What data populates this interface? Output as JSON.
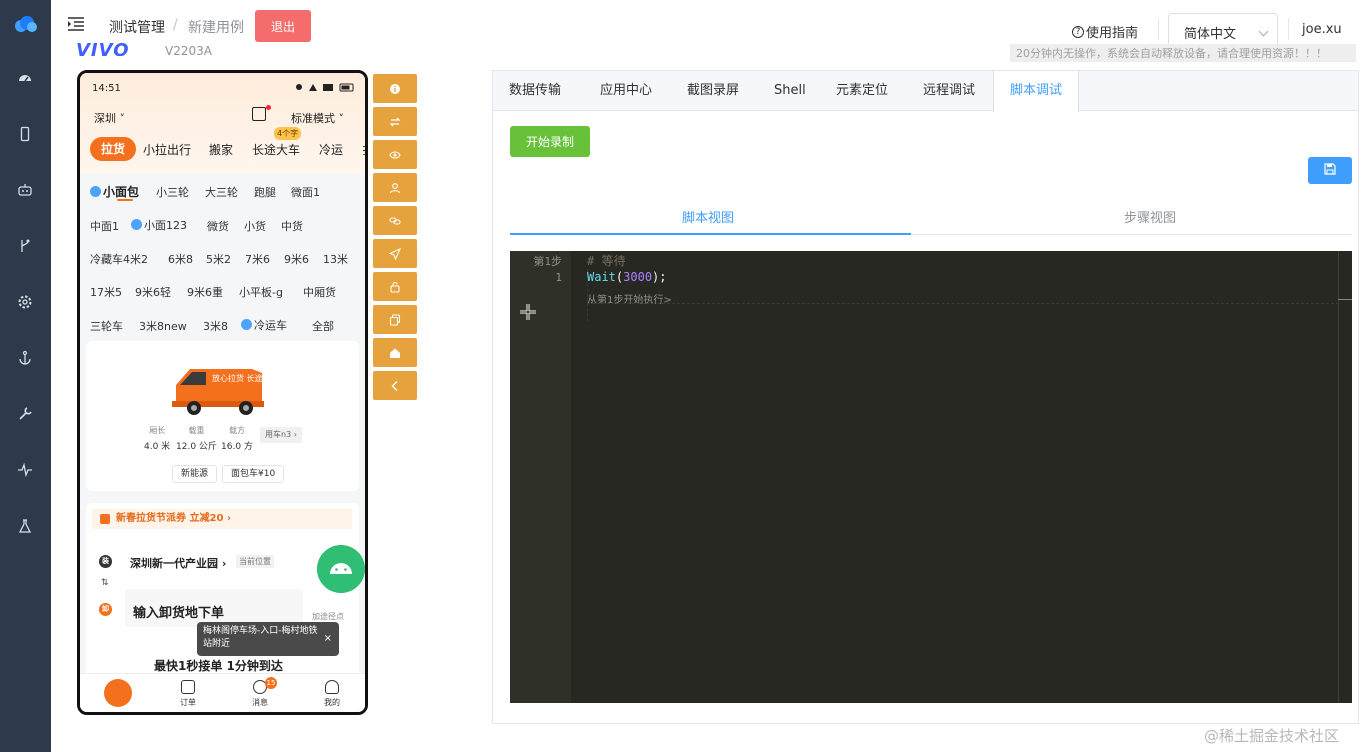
{
  "header": {
    "breadcrumb": [
      "测试管理",
      "新建用例"
    ],
    "breadcrumb_sep": "/",
    "exit_label": "退出",
    "help_label": "使用指南",
    "language": "简体中文",
    "user": "joe.xu"
  },
  "device": {
    "brand": "VIVO",
    "model": "V2203A",
    "warning": "20分钟内无操作，系统会自动释放设备，请合理使用资源！！！"
  },
  "phone": {
    "time": "14:51",
    "city": "深圳",
    "mode": "标准模式",
    "badge": "4个字",
    "categories": [
      "拉货",
      "小拉出行",
      "搬家",
      "长途大车",
      "冷运",
      "扌"
    ],
    "vehicles": [
      [
        "小面包",
        "小三轮",
        "大三轮",
        "跑腿",
        "微面1"
      ],
      [
        "中面1",
        "小面123",
        "微货",
        "小货",
        "中货"
      ],
      [
        "冷藏车4米2",
        "6米8",
        "5米2",
        "7米6",
        "9米6",
        "13米"
      ],
      [
        "17米5",
        "9米6轻",
        "9米6重",
        "小平板-g",
        "中厢货"
      ],
      [
        "三轮车",
        "3米8new",
        "3米8",
        "冷运车",
        "全部"
      ]
    ],
    "van_text": "放心拉货 长途搬家",
    "specs": [
      {
        "label": "厢长",
        "value": "4.0 米"
      },
      {
        "label": "载重",
        "value": "12.0 公斤"
      },
      {
        "label": "载方",
        "value": "16.0 方"
      }
    ],
    "use_car": "用车n3 ›",
    "pills": [
      "新能源",
      "面包车¥10"
    ],
    "promo": "新春拉货节派券 立减20 ›",
    "from_badge": "装",
    "from": "深圳新一代产业园 ›",
    "current_location": "当前位置",
    "swap": "⇅",
    "to_badge": "卸",
    "to": "输入卸货地下单",
    "add_stop": "加途径点",
    "tooltip": "梅林阁停车场-入口-梅村地铁站附近",
    "tooltip_close": "×",
    "fast": "最快1秒接单 1分钟到达",
    "tabbar": [
      "订单",
      "消息",
      "我的"
    ],
    "msg_count": "15"
  },
  "tabs": [
    "数据传输",
    "应用中心",
    "截图录屏",
    "Shell",
    "元素定位",
    "远程调试",
    "脚本调试"
  ],
  "active_tab": 6,
  "record_label": "开始录制",
  "view_tabs": [
    "脚本视图",
    "步骤视图"
  ],
  "editor": {
    "step_label": "第1步",
    "line_no": "1",
    "comment": "# 等待",
    "code_fn": "Wait",
    "code_open": "(",
    "code_num": "3000",
    "code_close": ");",
    "run_hint": "从第1步开始执行>"
  },
  "watermark": "@稀土掘金技术社区",
  "colors": {
    "sidebar": "#2e3a4c",
    "exit": "#f56c6c",
    "primary": "#409eff",
    "success": "#67c23a",
    "tool": "#e6a23c",
    "editor_bg": "#272822",
    "phone_accent": "#f5701c"
  },
  "icons": {
    "sidebar": [
      "dashboard-icon",
      "phone-icon",
      "robot-icon",
      "branch-icon",
      "gear-icon",
      "anchor-icon",
      "wrench-icon",
      "pulse-icon",
      "flask-icon"
    ],
    "tools": [
      "info-icon",
      "switch-icon",
      "eye-icon",
      "user-icon",
      "link-icon",
      "send-icon",
      "unlock-icon",
      "copy-icon",
      "home-icon",
      "back-icon"
    ]
  }
}
